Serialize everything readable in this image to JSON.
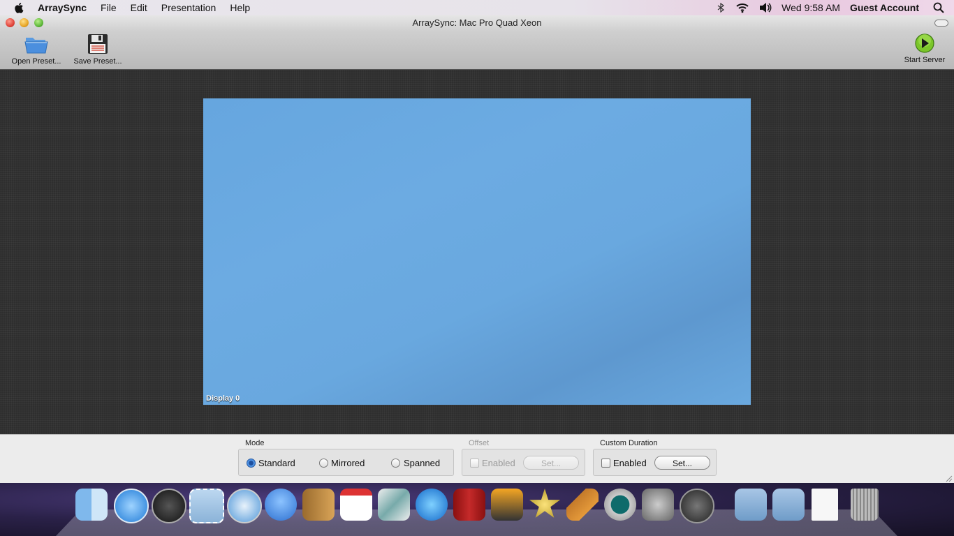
{
  "menubar": {
    "app_name": "ArraySync",
    "menus": [
      "File",
      "Edit",
      "Presentation",
      "Help"
    ],
    "clock": "Wed 9:58 AM",
    "user": "Guest Account"
  },
  "window": {
    "title": "ArraySync: Mac Pro Quad Xeon",
    "toolbar": {
      "open_label": "Open Preset...",
      "save_label": "Save Preset...",
      "start_label": "Start Server"
    }
  },
  "display": {
    "label": "Display 0"
  },
  "mode": {
    "title": "Mode",
    "options": [
      "Standard",
      "Mirrored",
      "Spanned"
    ],
    "selected": "Standard"
  },
  "offset": {
    "title": "Offset",
    "enabled_label": "Enabled",
    "set_label": "Set..."
  },
  "custom_duration": {
    "title": "Custom Duration",
    "enabled_label": "Enabled",
    "set_label": "Set..."
  },
  "dock": {
    "items": [
      "finder-icon",
      "app-store-icon",
      "dashboard-icon",
      "mail-icon",
      "safari-icon",
      "facetime-icon",
      "address-book-icon",
      "ical-icon",
      "preview-icon",
      "itunes-icon",
      "photo-booth-icon",
      "iphoto-icon",
      "imovie-icon",
      "garageband-icon",
      "time-machine-icon",
      "system-preferences-icon",
      "launchpad-icon",
      "applications-folder-icon",
      "documents-folder-icon",
      "pdf-document-icon",
      "trash-icon"
    ]
  }
}
